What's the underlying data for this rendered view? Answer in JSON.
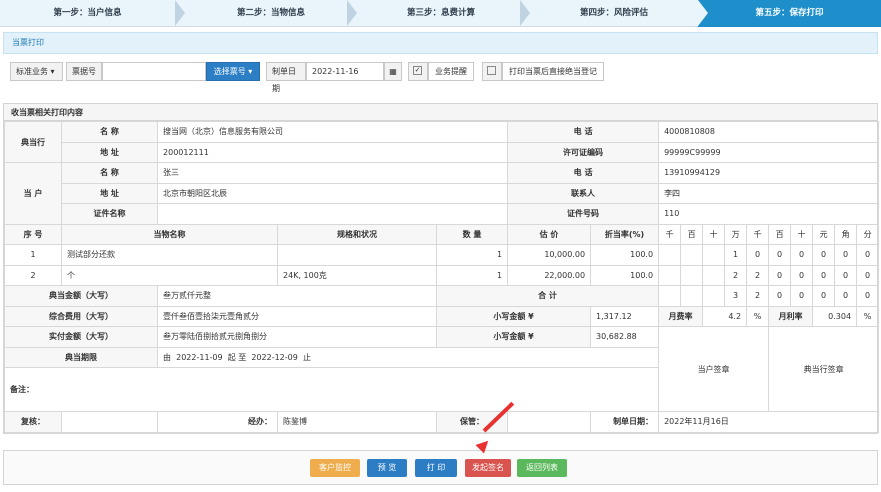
{
  "steps": [
    "第一步：当户信息",
    "第二步：当物信息",
    "第三步：息费计算",
    "第四步：风险评估",
    "第五步：保存打印"
  ],
  "panel_title": "当票打印",
  "toolbar": {
    "business_type": "标准业务",
    "ticket_label": "票据号",
    "ticket_value": "",
    "select_ticket": "选择票号",
    "date_label": "制单日期",
    "date_value": "2022-11-16",
    "business_remind": "业务提醒",
    "print_direct": "打印当票后直接绝当登记"
  },
  "section_title": "收当票相关打印内容",
  "pawnshop": {
    "label": "典当行",
    "name_label": "名 称",
    "name": "搜当网（北京）信息服务有限公司",
    "phone_label": "电 话",
    "phone": "4000810808",
    "addr_label": "地 址",
    "addr": "200012111",
    "license_label": "许可证编码",
    "license": "99999C99999"
  },
  "customer": {
    "label": "当 户",
    "name_label": "名 称",
    "name": "张三",
    "phone_label": "电 话",
    "phone": "13910994129",
    "addr_label": "地 址",
    "addr": "北京市朝阳区北辰",
    "contact_label": "联系人",
    "contact": "李四",
    "cert_name_label": "证件名称",
    "cert_name": "",
    "cert_no_label": "证件号码",
    "cert_no": "110"
  },
  "items_header": {
    "seq": "序 号",
    "name": "当物名称",
    "spec": "规格和状况",
    "qty": "数 量",
    "value": "估 价",
    "rate": "折当率(%)",
    "digits": [
      "千",
      "百",
      "十",
      "万",
      "千",
      "百",
      "十",
      "元",
      "角",
      "分"
    ]
  },
  "items": [
    {
      "seq": "1",
      "name": "测试部分还款",
      "spec": "",
      "qty": "1",
      "value": "10,000.00",
      "rate": "100.0",
      "digits": [
        "",
        "",
        "",
        "1",
        "0",
        "0",
        "0",
        "0",
        "0",
        "0"
      ]
    },
    {
      "seq": "2",
      "name": "个",
      "spec": "24K, 100克",
      "qty": "1",
      "value": "22,000.00",
      "rate": "100.0",
      "digits": [
        "",
        "",
        "",
        "2",
        "2",
        "0",
        "0",
        "0",
        "0",
        "0"
      ]
    }
  ],
  "totals": {
    "amount_label": "典当金额（大写）",
    "amount_cn": "叁万贰仟元整",
    "sum_label": "合 计",
    "sum_digits": [
      "",
      "",
      "",
      "3",
      "2",
      "0",
      "0",
      "0",
      "0",
      "0"
    ],
    "fee_label": "综合费用（大写）",
    "fee_cn": "壹仟叁佰壹拾柒元壹角贰分",
    "fee_small_label": "小写金额 ¥",
    "fee_small": "1,317.12",
    "monthly_fee_label": "月费率",
    "monthly_fee": "4.2",
    "monthly_rate_label": "月利率",
    "monthly_rate": "0.304",
    "pct": "%",
    "paid_label": "实付金额（大写）",
    "paid_cn": "叁万零陆佰捌拾贰元捌角捌分",
    "paid_small_label": "小写金额 ¥",
    "paid_small": "30,682.88",
    "period_label": "典当期限",
    "period_prefix": "由",
    "period_start": "2022-11-09",
    "period_mid": "起 至",
    "period_end": "2022-12-09",
    "period_suffix": "止",
    "customer_sign": "当户签章",
    "pawnshop_sign": "典当行签章",
    "remark_label": "备注："
  },
  "footer": {
    "review_label": "复核：",
    "review": "",
    "handler_label": "经办：",
    "handler": "陈鉴博",
    "keeper_label": "保管：",
    "keeper": "",
    "date_label": "制单日期：",
    "date": "2022年11月16日"
  },
  "buttons": {
    "monitor": "客户监控",
    "preview": "预 览",
    "print": "打 印",
    "sign": "发起签名",
    "back": "返回列表"
  },
  "colors": {
    "orange": "#f0ad4e",
    "blue": "#2d7dc4",
    "red": "#d9534f",
    "green": "#5cb85c",
    "accent": "#1f8fcb"
  }
}
